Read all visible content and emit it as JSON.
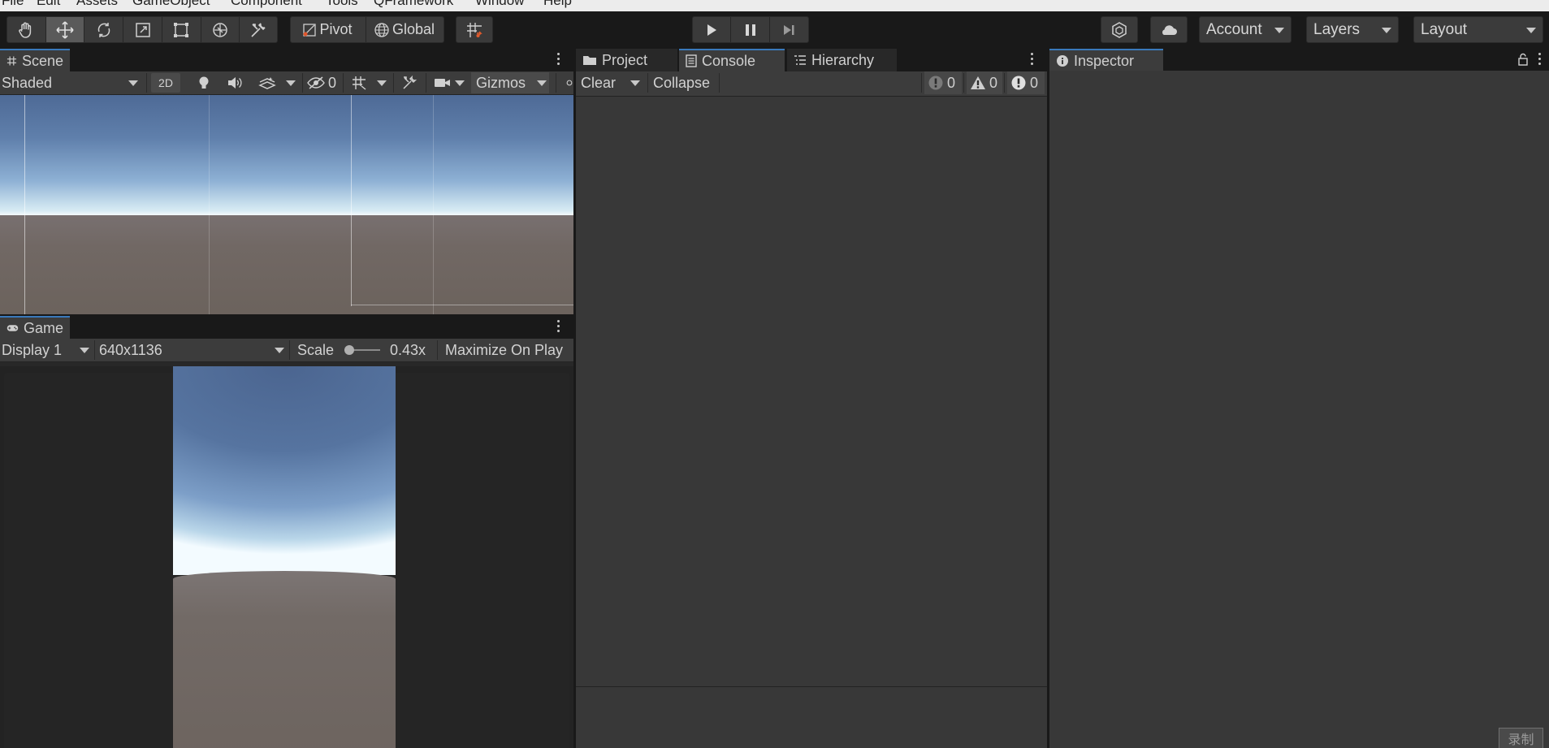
{
  "menu": {
    "items": [
      "File",
      "Edit",
      "Assets",
      "GameObject",
      "Component",
      "Tools",
      "QFramework",
      "Window",
      "Help"
    ]
  },
  "toolbar": {
    "tools": [
      "hand-tool",
      "move-tool",
      "rotate-tool",
      "scale-tool",
      "rect-tool",
      "transform-tool",
      "custom-editor-tool"
    ],
    "active_tool": "move-tool",
    "pivot_label": "Pivot",
    "global_label": "Global",
    "account_label": "Account",
    "layers_label": "Layers",
    "layout_label": "Layout"
  },
  "scene": {
    "tab_label": "Scene",
    "shading_mode": "Shaded",
    "mode_2d_label": "2D",
    "hidden_count": "0",
    "gizmos_label": "Gizmos"
  },
  "game": {
    "tab_label": "Game",
    "display_label": "Display 1",
    "resolution_label": "640x1136",
    "scale_label": "Scale",
    "scale_value": "0.43x",
    "maximize_label": "Maximize On Play"
  },
  "middle_tabs": {
    "project_label": "Project",
    "console_label": "Console",
    "hierarchy_label": "Hierarchy",
    "active": "Console"
  },
  "console": {
    "clear_label": "Clear",
    "collapse_label": "Collapse",
    "log_count": "0",
    "warning_count": "0",
    "error_count": "0"
  },
  "inspector": {
    "tab_label": "Inspector"
  },
  "overlay": {
    "record_label": "录制"
  },
  "colors": {
    "accent_tab": "#3a79bb",
    "panel_bg": "#383838",
    "toolbar_bg": "#191919"
  }
}
